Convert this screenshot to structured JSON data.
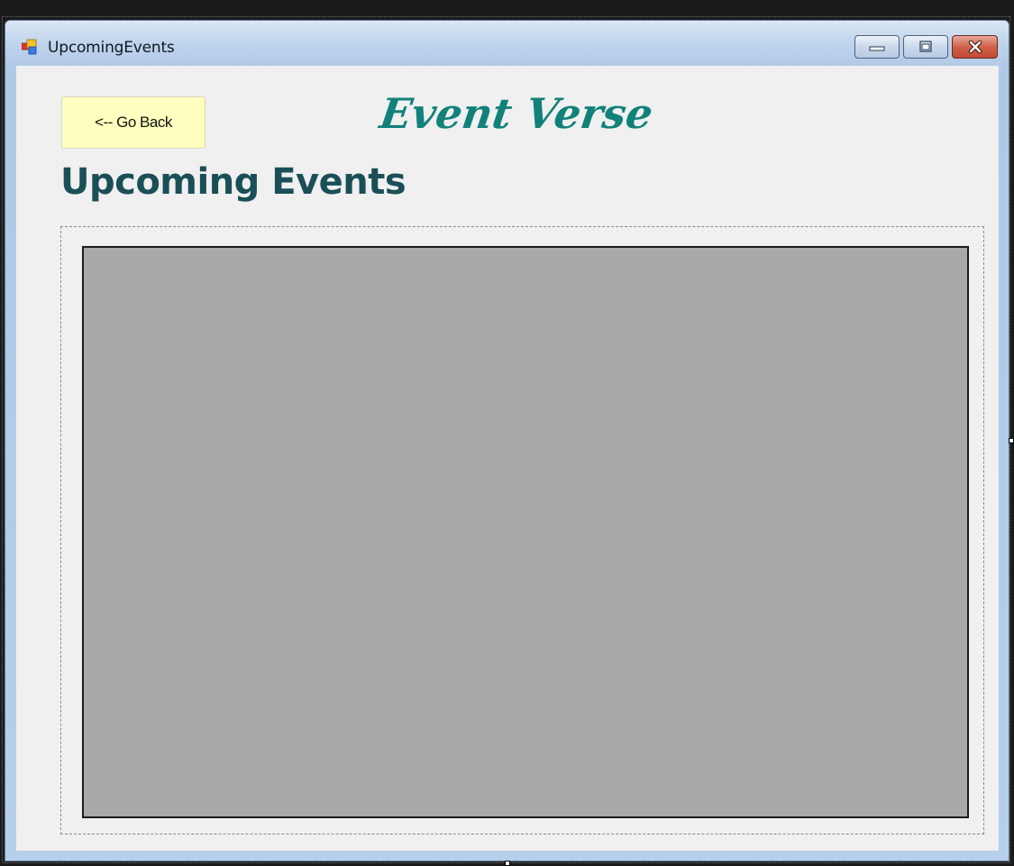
{
  "window": {
    "title": "UpcomingEvents",
    "icon": "form-icon"
  },
  "title_bar_buttons": {
    "minimize": "minimize-icon",
    "maximize": "maximize-icon",
    "close": "close-icon"
  },
  "header": {
    "back_label": "<-- Go Back",
    "brand": "Event Verse",
    "page_title": "Upcoming Events"
  },
  "colors": {
    "back_button_bg": "#ffffc0",
    "brand": "#12817a",
    "page_title": "#1a4f57",
    "list_bg": "#a9a9a9",
    "client_bg": "#f0f0f0"
  }
}
